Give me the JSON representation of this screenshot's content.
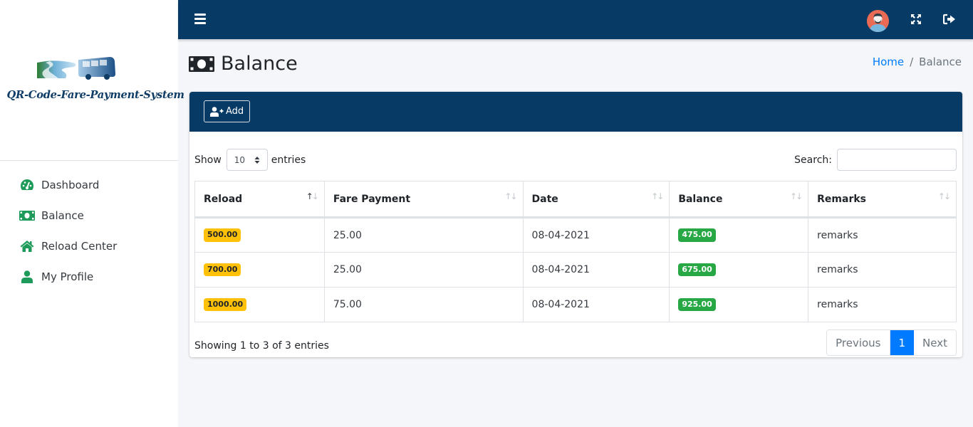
{
  "app": {
    "logo_text": "QR-Code-Fare-Payment-System"
  },
  "sidebar": {
    "items": [
      {
        "label": "Dashboard",
        "icon": "tachometer-icon"
      },
      {
        "label": "Balance",
        "icon": "money-bill-icon"
      },
      {
        "label": "Reload Center",
        "icon": "home-icon"
      },
      {
        "label": "My Profile",
        "icon": "user-icon"
      }
    ]
  },
  "header": {
    "menu_icon": "hamburger-icon",
    "avatar_icon": "user-avatar",
    "fullscreen_icon": "expand-icon",
    "logout_icon": "sign-out-icon"
  },
  "page": {
    "title": "Balance",
    "title_icon": "money-bill-icon",
    "breadcrumb": {
      "home": "Home",
      "separator": "/",
      "current": "Balance"
    }
  },
  "card": {
    "add_label": "Add",
    "add_icon": "user-plus-icon",
    "show_label": "Show",
    "entries_label": "entries",
    "page_length": "10",
    "search_label": "Search:",
    "search_value": ""
  },
  "table": {
    "columns": [
      "Reload",
      "Fare Payment",
      "Date",
      "Balance",
      "Remarks"
    ],
    "sorted_column": "Reload",
    "rows": [
      {
        "reload": "500.00",
        "fare_payment": "25.00",
        "date": "08-04-2021",
        "balance": "475.00",
        "remarks": "remarks"
      },
      {
        "reload": "700.00",
        "fare_payment": "25.00",
        "date": "08-04-2021",
        "balance": "675.00",
        "remarks": "remarks"
      },
      {
        "reload": "1000.00",
        "fare_payment": "75.00",
        "date": "08-04-2021",
        "balance": "925.00",
        "remarks": "remarks"
      }
    ]
  },
  "footer": {
    "info": "Showing 1 to 3 of 3 entries",
    "pagination": {
      "previous": "Previous",
      "current": "1",
      "next": "Next"
    }
  },
  "colors": {
    "primary_dark": "#073b66",
    "sidebar_icon": "#1e9b5a",
    "badge_warning": "#ffc107",
    "badge_success": "#28a745",
    "link": "#007bff"
  }
}
